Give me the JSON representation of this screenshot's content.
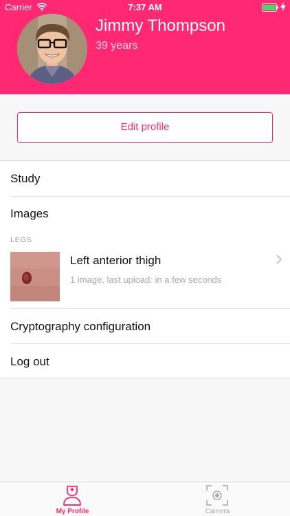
{
  "status_bar": {
    "carrier": "Carrier",
    "time": "7:37 AM"
  },
  "profile": {
    "name": "Jimmy Thompson",
    "age": "39 years",
    "edit_label": "Edit profile"
  },
  "menu": {
    "study": "Study",
    "images": "Images",
    "cryptography": "Cryptography configuration",
    "logout": "Log out"
  },
  "images_section": {
    "header": "LEGS",
    "items": [
      {
        "title": "Left anterior thigh",
        "subtitle": "1 image, last upload: in a few seconds"
      }
    ]
  },
  "tabbar": {
    "tabs": [
      {
        "label": "My Profile",
        "icon": "doctor-icon",
        "active": true
      },
      {
        "label": "Camera",
        "icon": "camera-icon",
        "active": false
      }
    ]
  },
  "colors": {
    "accent": "#fe2873",
    "background": "#f7f7f7",
    "inactive": "#a8a8a8"
  }
}
